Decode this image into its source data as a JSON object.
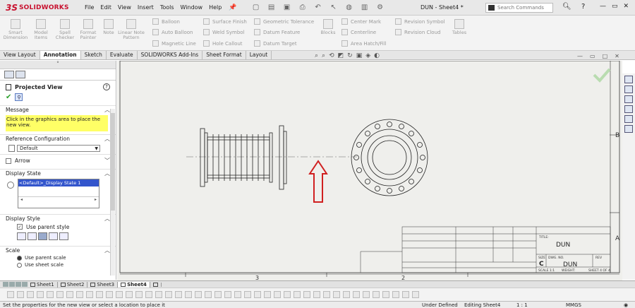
{
  "app": {
    "brand_ds": "3S",
    "brand_name": "SOLIDWORKS",
    "doc_title": "DUN - Sheet4 *"
  },
  "menu": [
    "File",
    "Edit",
    "View",
    "Insert",
    "Tools",
    "Window",
    "Help"
  ],
  "search": {
    "placeholder": "Search Commands"
  },
  "ribbon": {
    "large": [
      "Smart Dimension",
      "Model Items",
      "Spell Checker",
      "Format Painter",
      "Note",
      "Linear Note Pattern",
      "Blocks",
      "Tables"
    ],
    "rows": [
      [
        "Balloon",
        "Surface Finish",
        "Geometric Tolerance",
        "Center Mark",
        "Revision Symbol"
      ],
      [
        "Auto Balloon",
        "Weld Symbol",
        "Datum Feature",
        "Centerline",
        "Revision Cloud"
      ],
      [
        "Magnetic Line",
        "Hole Callout",
        "Datum Target",
        "Area Hatch/Fill"
      ]
    ]
  },
  "tabs": [
    "View Layout",
    "Annotation",
    "Sketch",
    "Evaluate",
    "SOLIDWORKS Add-Ins",
    "Sheet Format",
    "Layout"
  ],
  "panel": {
    "title": "Projected View",
    "help": "?",
    "sections": {
      "message": "Message",
      "message_text": "Click in the graphics area to place the new view.",
      "ref_config": "Reference Configuration",
      "ref_config_value": "Default",
      "arrow": "Arrow",
      "display_state": "Display State",
      "display_state_value": "<Default>_Display State 1",
      "display_style": "Display Style",
      "use_parent_style": "Use parent style",
      "scale": "Scale",
      "use_parent_scale": "Use parent scale",
      "use_sheet_scale": "Use sheet scale"
    }
  },
  "drawing": {
    "right_margin_B": "B",
    "right_margin_A": "A",
    "bottom_zone_3": "3",
    "bottom_zone_2": "2",
    "title_block": {
      "title": "DUN",
      "dwg_no": "DUN",
      "size": "C",
      "scale_label": "SCALE 1:1",
      "weight": "WEIGHT:",
      "sheet": "SHEET 4 OF 4",
      "dwg_no_label": "DWG. NO.",
      "rev": "REV",
      "size_label": "SIZE",
      "title_label": "TITLE:"
    }
  },
  "sheets": [
    "Sheet1",
    "Sheet2",
    "Sheet3",
    "Sheet4"
  ],
  "active_sheet": "Sheet4",
  "status": {
    "hint": "Set the properties for the new view or select a location to place it",
    "defined": "Under Defined",
    "editing": "Editing Sheet4",
    "scale": "1 : 1",
    "units": "MMGS"
  },
  "colors": {
    "brand": "#c8102e",
    "arrow": "#d02020",
    "message_bg": "#ffff66",
    "graphics_bg": "#efefec"
  }
}
